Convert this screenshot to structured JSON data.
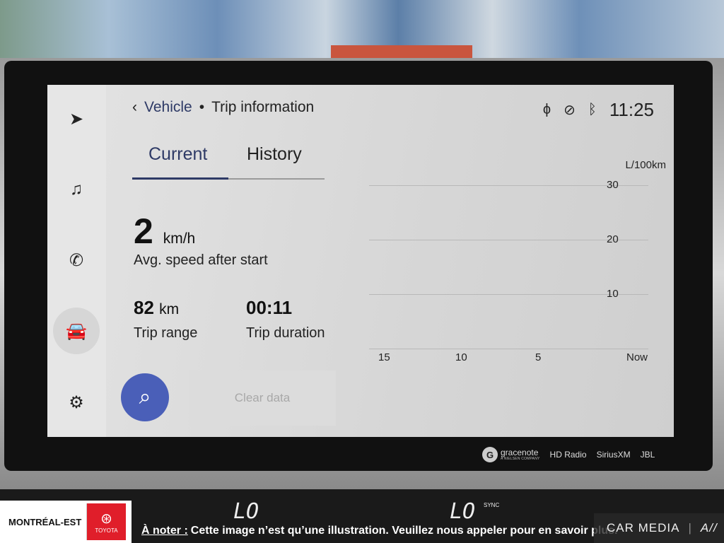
{
  "header": {
    "back_icon": "chevron-left-icon",
    "section": "Vehicle",
    "separator": "•",
    "title": "Trip information"
  },
  "status": {
    "icons": [
      "wireless-charging-icon",
      "voice-off-icon",
      "bluetooth-icon"
    ],
    "time": "11:25"
  },
  "sidebar": {
    "items": [
      {
        "icon": "navigation-icon"
      },
      {
        "icon": "music-icon"
      },
      {
        "icon": "phone-icon"
      },
      {
        "icon": "car-icon",
        "active": true
      },
      {
        "icon": "gear-icon"
      }
    ]
  },
  "tabs": [
    {
      "label": "Current",
      "active": true
    },
    {
      "label": "History",
      "active": false
    }
  ],
  "stats": {
    "avg_speed": {
      "value": "2",
      "unit": "km/h",
      "label": "Avg. speed after start"
    },
    "range": {
      "value": "82",
      "unit": "km",
      "label": "Trip range"
    },
    "duration": {
      "value": "00:11",
      "label": "Trip duration"
    }
  },
  "actions": {
    "search_icon": "search-icon",
    "clear_label": "Clear data"
  },
  "chart": {
    "unit": "L/100km",
    "y_ticks": [
      "30",
      "20",
      "10"
    ],
    "x_ticks": [
      "15",
      "10",
      "5",
      "Now"
    ]
  },
  "brands": [
    "gracenote",
    "A NIELSEN COMPANY",
    "HD Radio",
    "SiriusXM",
    "JBL"
  ],
  "climate": {
    "left": "LO",
    "right": "LO",
    "sync": "SYNC"
  },
  "overlay": {
    "dealer": "MONTRÉAL-EST",
    "brand": "TOYOTA",
    "note_prefix": "À noter :",
    "note": "Cette image n’est qu’une illustration. Veuillez nous appeler pour en savoir plus.",
    "watermark": "CAR MEDIA",
    "watermark_mark": "A//"
  },
  "colors": {
    "accent": "#4a5fb8",
    "title": "#2e3a66",
    "toyota_red": "#e01e2a"
  }
}
